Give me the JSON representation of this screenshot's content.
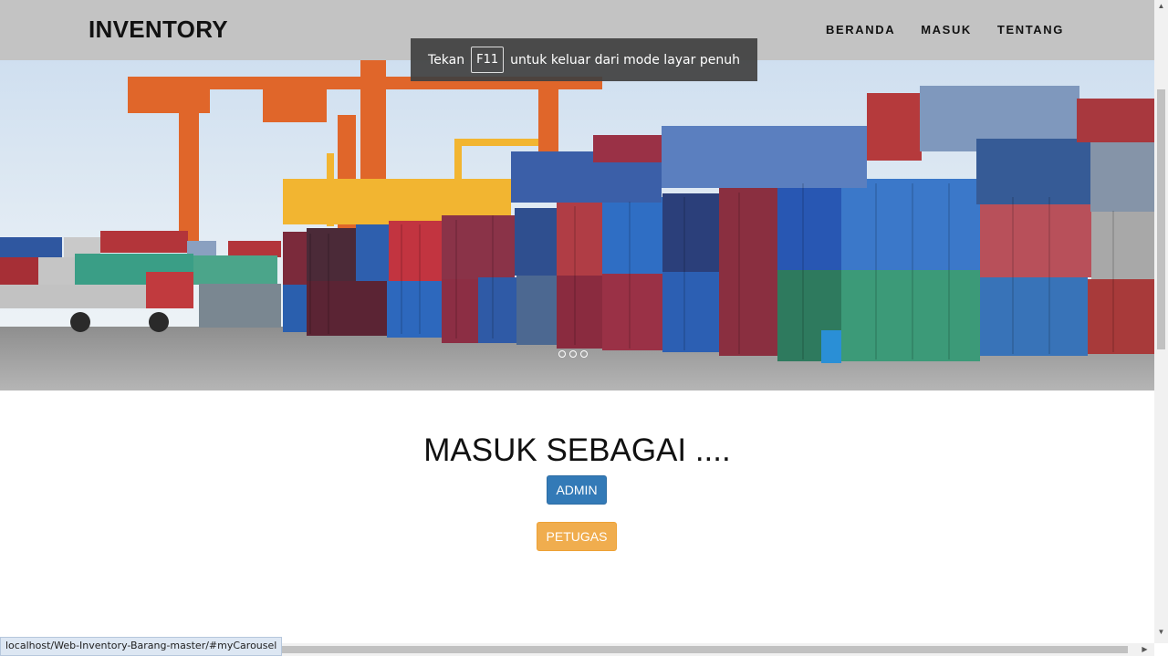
{
  "navbar": {
    "brand": "INVENTORY",
    "links": [
      "BERANDA",
      "MASUK",
      "TENTANG"
    ],
    "background": "#c3c3c3"
  },
  "fullscreen_toast": {
    "before": "Tekan",
    "key": "F11",
    "after": "untuk keluar dari mode layar penuh"
  },
  "carousel": {
    "slide_count": 3,
    "active_index": 0
  },
  "login": {
    "heading": "MASUK SEBAGAI ....",
    "admin_label": "ADMIN",
    "petugas_label": "PETUGAS",
    "admin_color": "#337ab7",
    "petugas_color": "#f0ad4e"
  },
  "status_bar": {
    "url": "localhost/Web-Inventory-Barang-master/#myCarousel"
  }
}
